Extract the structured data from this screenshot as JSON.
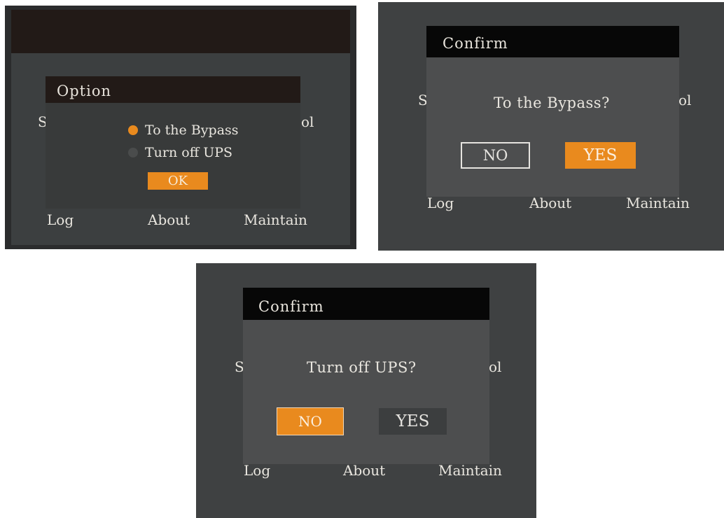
{
  "screen1": {
    "dialog_title": "Option",
    "bg_left": "S",
    "bg_right": "ol",
    "options": [
      {
        "label": "To the Bypass",
        "selected": true
      },
      {
        "label": "Turn off UPS",
        "selected": false
      }
    ],
    "ok_label": "OK",
    "menu": [
      "Log",
      "About",
      "Maintain"
    ]
  },
  "screen2": {
    "dialog_title": "Confirm",
    "question": "To the Bypass?",
    "bg_left": "S",
    "bg_right": "ol",
    "no_label": "NO",
    "yes_label": "YES",
    "focused": "YES",
    "menu": [
      "Log",
      "About",
      "Maintain"
    ]
  },
  "screen3": {
    "dialog_title": "Confirm",
    "question": "Turn off UPS?",
    "bg_left": "S",
    "bg_right": "ol",
    "no_label": "NO",
    "yes_label": "YES",
    "focused": "NO",
    "menu": [
      "Log",
      "About",
      "Maintain"
    ]
  },
  "colors": {
    "accent": "#e98a1e",
    "titlebar_dark": "#221a17",
    "titlebar_black": "#070707",
    "screen_bg": "#3f4142",
    "dialog_bg": "#4d4e4f"
  }
}
